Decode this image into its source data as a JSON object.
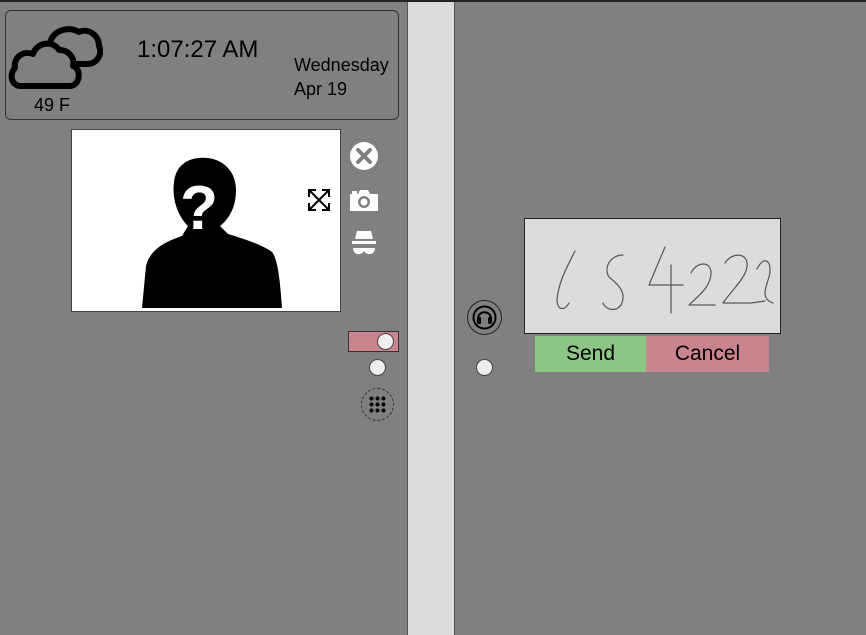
{
  "weather": {
    "temperature": "49 F",
    "condition_icon": "cloudy-icon"
  },
  "clock": {
    "time": "1:07:27 AM",
    "day": "Wednesday",
    "date": "Apr 19"
  },
  "video": {
    "placeholder_icon": "unknown-person-icon",
    "expand_icon": "expand-icon"
  },
  "side_controls": {
    "icons": [
      "close-icon",
      "camera-icon",
      "incognito-icon",
      "keypad-icon"
    ],
    "toggle_color": "#c9848d"
  },
  "signature": {
    "handwritten_text": "LS422"
  },
  "actions": {
    "send_label": "Send",
    "cancel_label": "Cancel",
    "send_color": "#8cc585",
    "cancel_color": "#c9848d"
  },
  "colors": {
    "background": "#808080",
    "divider": "#dcdcdc",
    "signature_bg": "#dcdcdc"
  }
}
